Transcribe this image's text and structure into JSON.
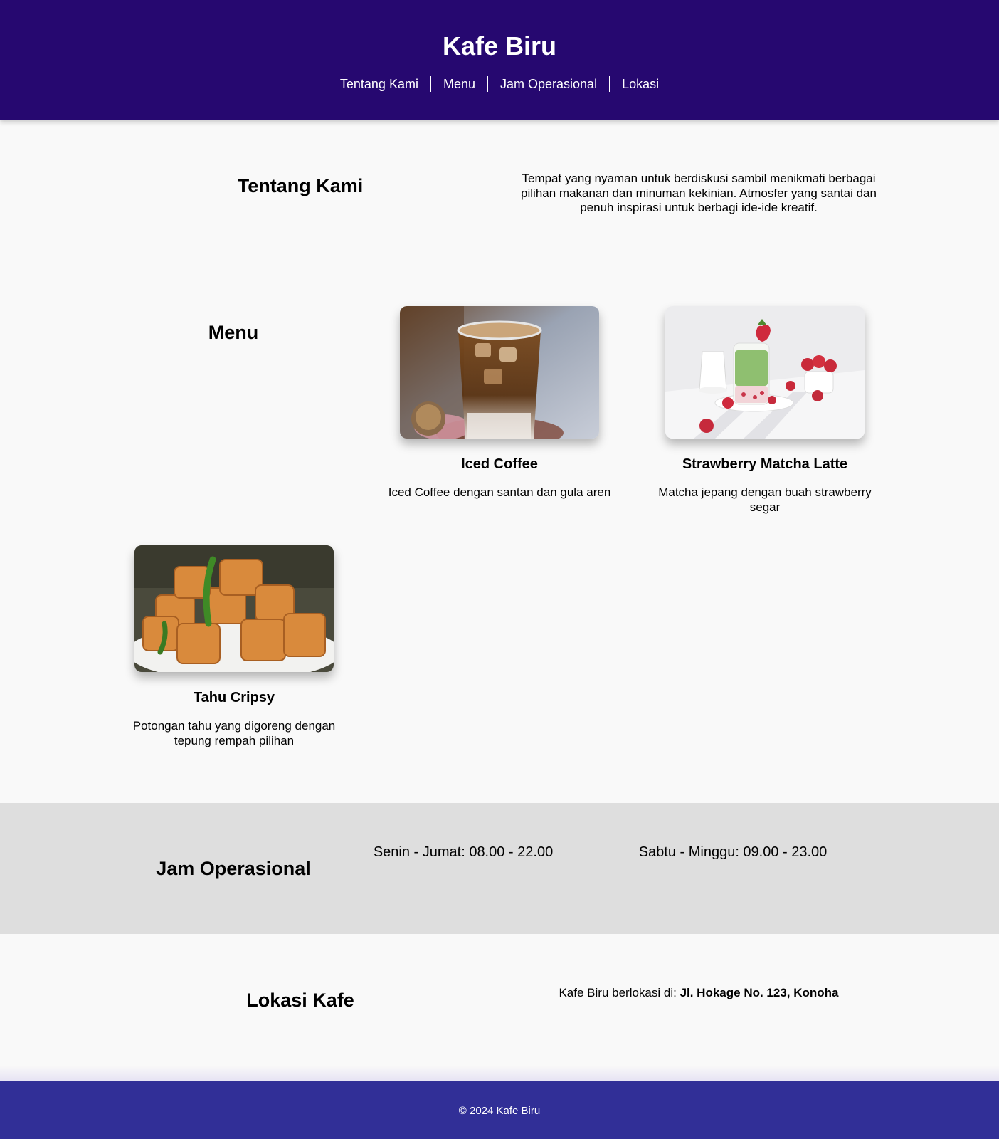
{
  "header": {
    "title": "Kafe Biru",
    "nav": [
      "Tentang Kami",
      "Menu",
      "Jam Operasional",
      "Lokasi"
    ]
  },
  "about": {
    "title": "Tentang Kami",
    "text": "Tempat yang nyaman untuk berdiskusi sambil menikmati berbagai pilihan makanan dan minuman kekinian. Atmosfer yang santai dan penuh inspirasi untuk berbagi ide-ide kreatif."
  },
  "menu": {
    "title": "Menu",
    "items": [
      {
        "name": "Iced Coffee",
        "desc": "Iced Coffee dengan santan dan gula aren",
        "image": "iced-coffee-photo"
      },
      {
        "name": "Strawberry Matcha Latte",
        "desc": "Matcha jepang dengan buah strawberry segar",
        "image": "matcha-latte-photo"
      },
      {
        "name": "Tahu Cripsy",
        "desc": "Potongan tahu yang digoreng dengan tepung rempah pilihan",
        "image": "tahu-crispy-photo"
      }
    ]
  },
  "hours": {
    "title": "Jam Operasional",
    "weekday": "Senin - Jumat: 08.00 - 22.00",
    "weekend": "Sabtu - Minggu: 09.00 - 23.00"
  },
  "location": {
    "title": "Lokasi Kafe",
    "prefix": "Kafe Biru berlokasi di: ",
    "address": "Jl. Hokage No. 123, Konoha"
  },
  "footer": {
    "text": "© 2024 Kafe Biru"
  },
  "colors": {
    "header_bg": "#260870",
    "footer_bg": "#312f97",
    "hours_bg": "#dedede",
    "page_bg": "#f9f9f9"
  }
}
